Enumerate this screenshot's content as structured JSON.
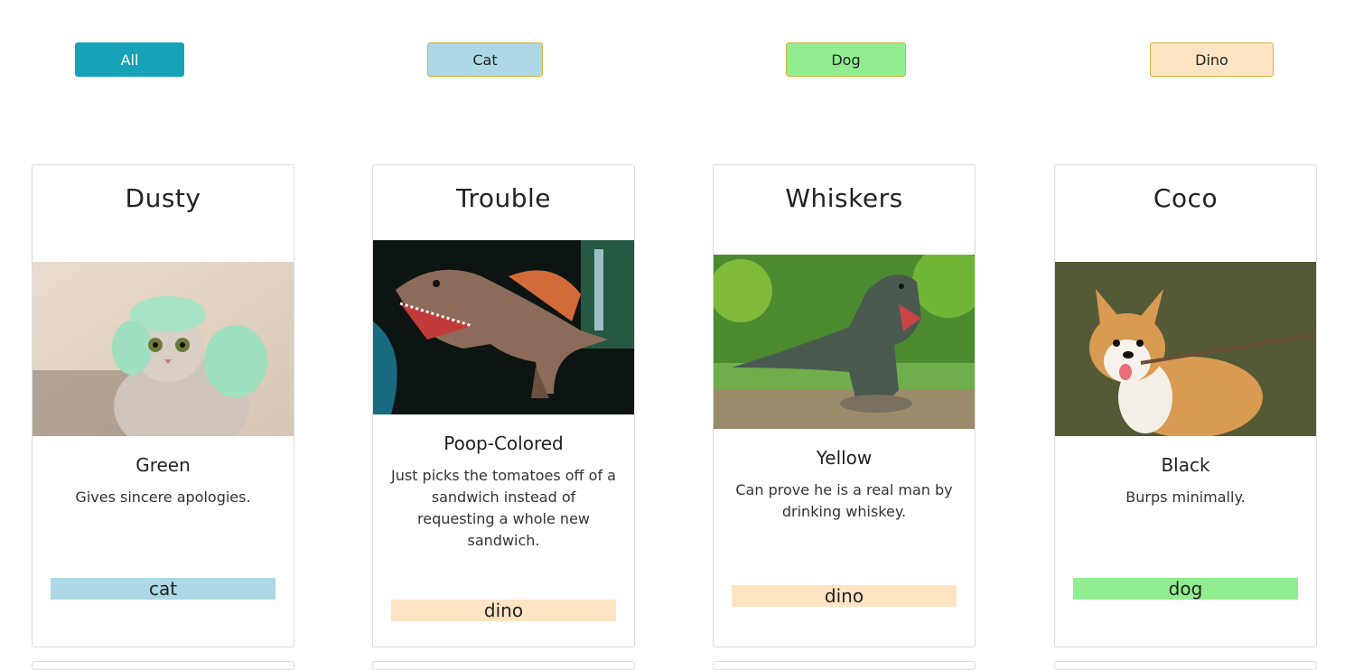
{
  "filters": {
    "all_label": "All",
    "cat_label": "Cat",
    "dog_label": "Dog",
    "dino_label": "Dino"
  },
  "colors": {
    "all": "#17a2b8",
    "cat": "#add8e6",
    "dog": "#90ee90",
    "dino": "#ffe4c4"
  },
  "cards": [
    {
      "name": "Dusty",
      "color": "Green",
      "description": "Gives sincere apologies.",
      "tag": "cat",
      "image_icon": "cat-photo"
    },
    {
      "name": "Trouble",
      "color": "Poop-Colored",
      "description": "Just picks the tomatoes off of a sandwich instead of requesting a whole new sandwich.",
      "tag": "dino",
      "image_icon": "dinosaur-photo"
    },
    {
      "name": "Whiskers",
      "color": "Yellow",
      "description": "Can prove he is a real man by drinking whiskey.",
      "tag": "dino",
      "image_icon": "dinosaur-photo"
    },
    {
      "name": "Coco",
      "color": "Black",
      "description": "Burps minimally.",
      "tag": "dog",
      "image_icon": "dog-photo"
    }
  ]
}
